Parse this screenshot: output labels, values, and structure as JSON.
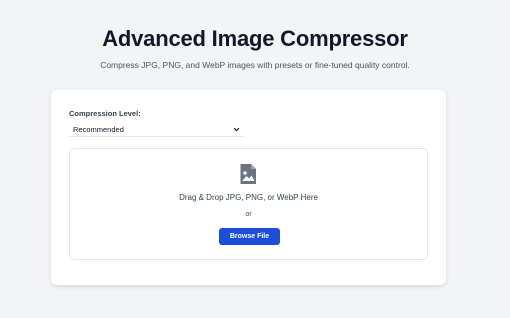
{
  "header": {
    "title": "Advanced Image Compressor",
    "subtitle": "Compress JPG, PNG, and WebP images with presets or fine-tuned quality control."
  },
  "compression": {
    "label": "Compression Level:",
    "selected": "Recommended",
    "dropdown_icon": "chevron-down-icon"
  },
  "dropzone": {
    "icon": "image-file-icon",
    "text": "Drag & Drop JPG, PNG, or WebP Here",
    "or_text": "or",
    "browse_label": "Browse File"
  },
  "colors": {
    "accent": "#1d4ed8",
    "background": "#f3f4f6",
    "card": "#ffffff"
  }
}
